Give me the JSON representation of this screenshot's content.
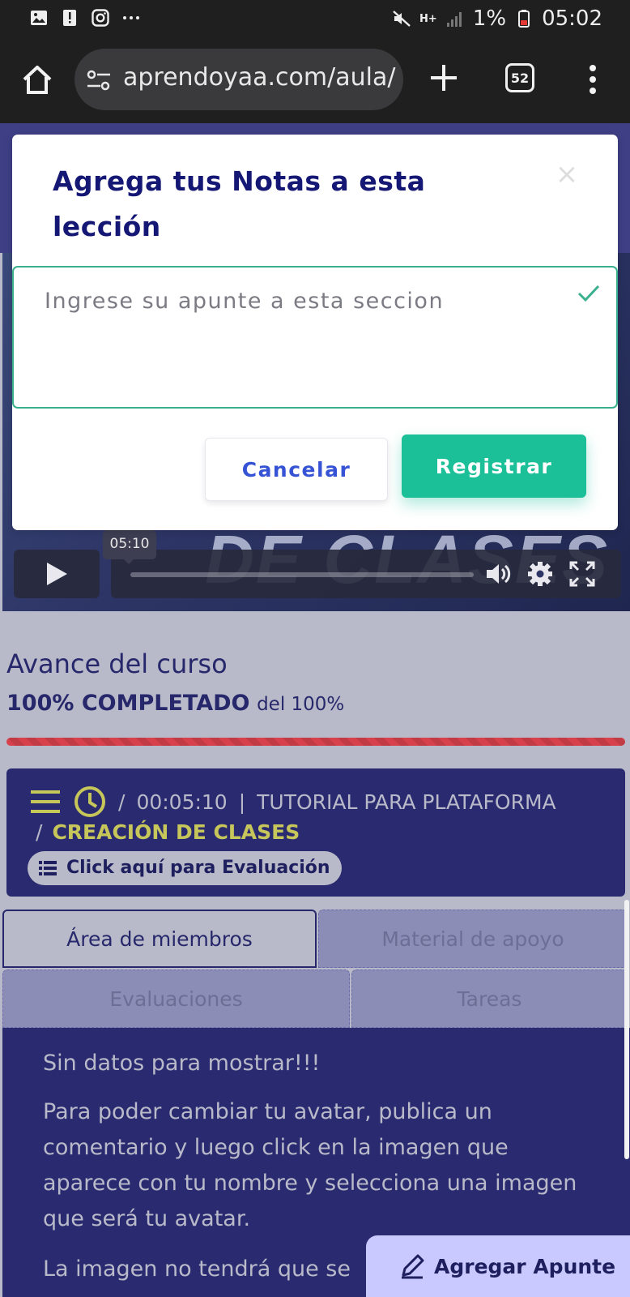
{
  "status_bar": {
    "battery": "1%",
    "time": "05:02",
    "network": "H+"
  },
  "browser": {
    "url": "aprendoyaa.com/aula/",
    "tab_count": "52"
  },
  "modal": {
    "title": "Agrega tus Notas a esta lección",
    "close_symbol": "×",
    "note_placeholder": "Ingrese su apunte a esta seccion",
    "cancel_label": "Cancelar",
    "register_label": "Registrar"
  },
  "video": {
    "time_tooltip": "05:10",
    "brand_text": "DE CLASES"
  },
  "progress": {
    "title": "Avance del curso",
    "percent_label": "100% COMPLETADO",
    "of_label": "del 100%",
    "value": 1.0
  },
  "lesson": {
    "sep1": "/",
    "duration": "00:05:10",
    "divider": "|",
    "course": "TUTORIAL PARA PLATAFORMA",
    "sep2": "/",
    "name": "CREACIÓN DE CLASES",
    "eval_button": "Click aquí para Evaluación"
  },
  "tabs": {
    "members": "Área de miembros",
    "support": "Material de apoyo",
    "evaluations": "Evaluaciones",
    "tasks": "Tareas"
  },
  "content": {
    "empty": "Sin datos para mostrar!!!",
    "avatar_help": "Para poder cambiar tu avatar, publica un comentario y luego click en la imagen que aparece con tu nombre y selecciona una imagen que será tu avatar.",
    "image_note": "La imagen no tendrá que se"
  },
  "fab": {
    "label": "Agregar Apunte"
  },
  "colors": {
    "modal_title": "#141774",
    "accent_green": "#1bbf98",
    "cancel_blue": "#3553d4",
    "progress_red": "#d6414b",
    "lesson_yellow": "#c7c65a",
    "panel_navy": "#2a2a70"
  }
}
